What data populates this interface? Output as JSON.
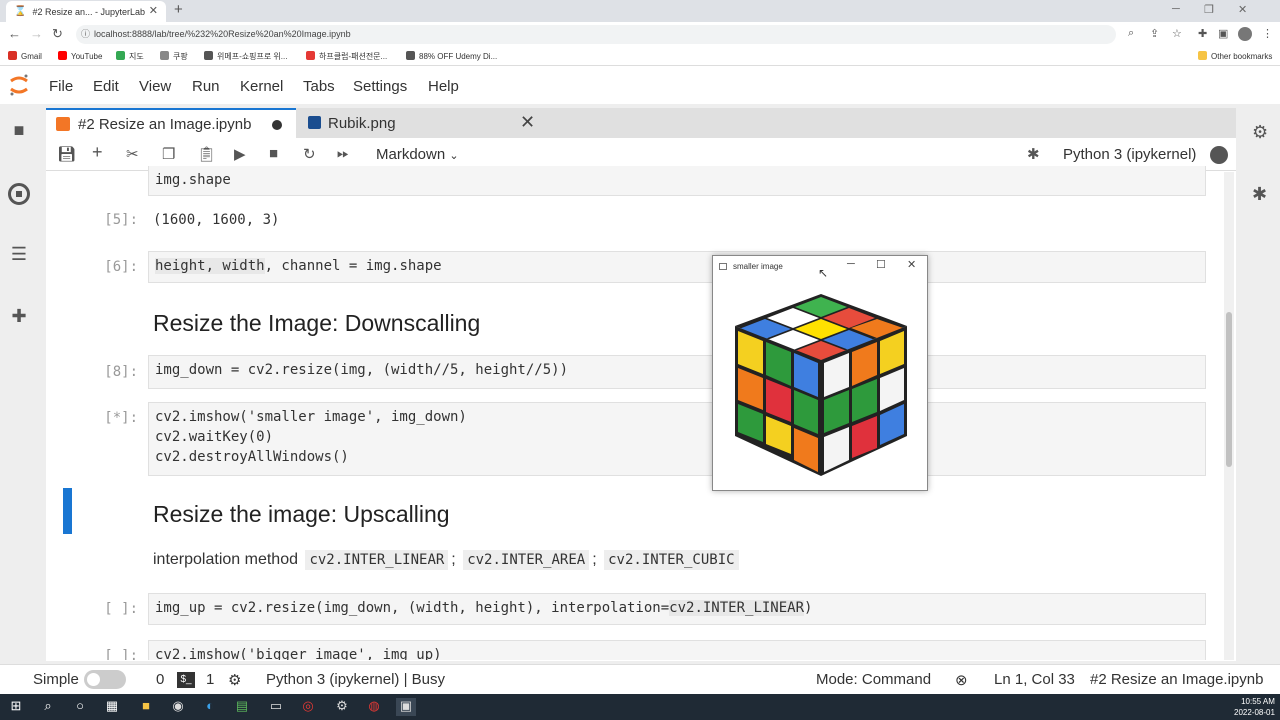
{
  "browser": {
    "tab_title": "#2 Resize an... - JupyterLab",
    "new_tab": "+",
    "url": "localhost:8888/lab/tree/%232%20Resize%20an%20Image.ipynb",
    "bookmarks": [
      "Gmail",
      "YouTube",
      "지도",
      "쿠팡",
      "위메프-쇼핑프로 위...",
      "하프클럽-패션전문...",
      "88% OFF Udemy Di..."
    ],
    "other_bookmarks": "Other bookmarks"
  },
  "menu": [
    "File",
    "Edit",
    "View",
    "Run",
    "Kernel",
    "Tabs",
    "Settings",
    "Help"
  ],
  "tabs": {
    "notebook": "#2 Resize an Image.ipynb",
    "image": "Rubik.png"
  },
  "toolbar": {
    "cell_type": "Markdown",
    "kernel": "Python 3 (ipykernel)"
  },
  "cells": {
    "c_shape_code": "img.shape",
    "c5_prompt": "[5]:",
    "c5_out": "(1600, 1600, 3)",
    "c6_prompt": "[6]:",
    "c6_code_a": "height, width",
    "c6_code_b": ", channel = img.shape",
    "h_down": "Resize the Image: Downscalling",
    "c8_prompt": "[8]:",
    "c8_code": "img_down = cv2.resize(img, (width//5, height//5))",
    "cstar_prompt": "[*]:",
    "cstar_l1": "cv2.imshow('smaller image', img_down)",
    "cstar_l2": "cv2.waitKey(0)",
    "cstar_l3": "cv2.destroyAllWindows()",
    "h_up": "Resize the image: Upscalling",
    "interp_text": "interpolation method",
    "interp_1": "cv2.INTER_LINEAR",
    "interp_sep1": ";",
    "interp_2": "cv2.INTER_AREA",
    "interp_sep2": ";",
    "interp_3": "cv2.INTER_CUBIC",
    "cup_prompt": "[ ]:",
    "cup_code_a": "img_up = cv2.resize(img_down, (width, height), interpolation=",
    "cup_code_b": "cv2.INTER_LINEAR",
    "cup_code_c": ")",
    "clast_prompt": "[ ]:",
    "clast_code": "cv2.imshow('bigger image', img_up)"
  },
  "popup": {
    "title": "smaller image"
  },
  "status": {
    "mode_label": "Simple",
    "count1": "0",
    "count2": "1",
    "kernel_status": "Python 3 (ipykernel) | Busy",
    "mode": "Mode: Command",
    "position": "Ln 1, Col 33",
    "file": "#2 Resize an Image.ipynb"
  },
  "taskbar": {
    "time": "10:55 AM",
    "date": "2022-08-01"
  },
  "colors": {
    "accent": "#1976d2",
    "jupyter_orange": "#f37626"
  }
}
